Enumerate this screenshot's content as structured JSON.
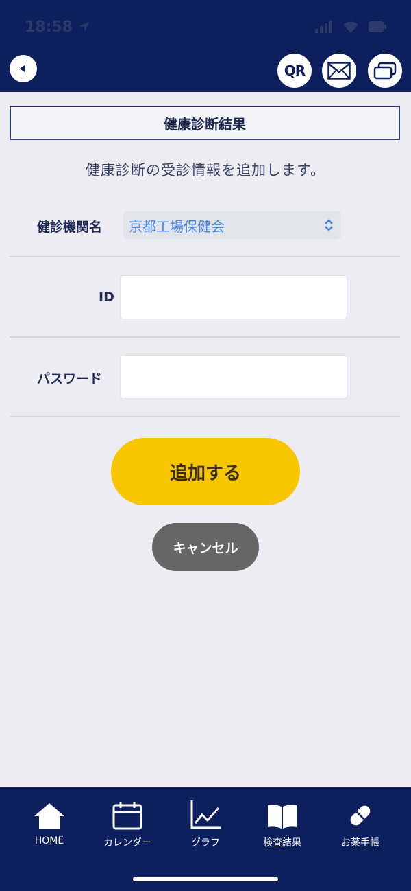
{
  "status_bar": {
    "time": "18:58"
  },
  "header": {
    "title": "健康診断結果"
  },
  "toolbar": {
    "qr_label": "QR"
  },
  "form": {
    "description": "健康診断の受診情報を追加します。",
    "institution_label": "健診機関名",
    "institution_value": "京都工場保健会",
    "id_label": "ID",
    "id_value": "",
    "password_label": "パスワード",
    "password_value": ""
  },
  "actions": {
    "add_label": "追加する",
    "cancel_label": "キャンセル"
  },
  "tabbar": {
    "items": [
      {
        "label": "HOME",
        "icon": "home-icon"
      },
      {
        "label": "カレンダー",
        "icon": "calendar-icon"
      },
      {
        "label": "グラフ",
        "icon": "chart-icon"
      },
      {
        "label": "検査結果",
        "icon": "book-icon"
      },
      {
        "label": "お薬手帳",
        "icon": "pill-icon"
      }
    ]
  },
  "colors": {
    "navy": "#0d1f5c",
    "accent_yellow": "#f7c600",
    "cancel_gray": "#666666",
    "link_blue": "#4a86e0"
  }
}
